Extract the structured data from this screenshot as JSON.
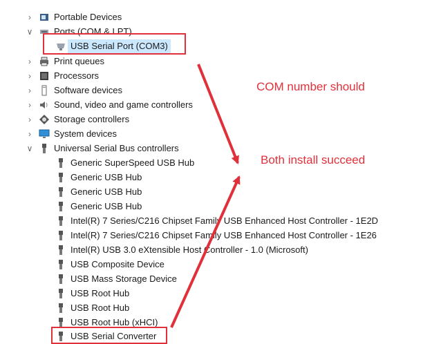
{
  "tree": {
    "categories": {
      "top_partial": "",
      "portable_devices": "Portable Devices",
      "ports": "Ports (COM & LPT)",
      "usb_serial_port": "USB Serial Port (COM3)",
      "print_queues": "Print queues",
      "processors": "Processors",
      "software_devices": "Software devices",
      "sound": "Sound, video and game controllers",
      "storage": "Storage controllers",
      "system_devices": "System devices",
      "usb_controllers": "Universal Serial Bus controllers"
    },
    "usb_children": [
      "Generic SuperSpeed USB Hub",
      "Generic USB Hub",
      "Generic USB Hub",
      "Generic USB Hub",
      "Intel(R) 7 Series/C216 Chipset Family USB Enhanced Host Controller - 1E2D",
      "Intel(R) 7 Series/C216 Chipset Family USB Enhanced Host Controller - 1E26",
      "Intel(R) USB 3.0 eXtensible Host Controller - 1.0 (Microsoft)",
      "USB Composite Device",
      "USB Mass Storage Device",
      "USB Root Hub",
      "USB Root Hub",
      "USB Root Hub (xHCI)",
      "USB Serial Converter"
    ]
  },
  "annotations": {
    "note1": "COM number should",
    "note2": "Both install succeed",
    "accent_color": "#e0313b"
  }
}
